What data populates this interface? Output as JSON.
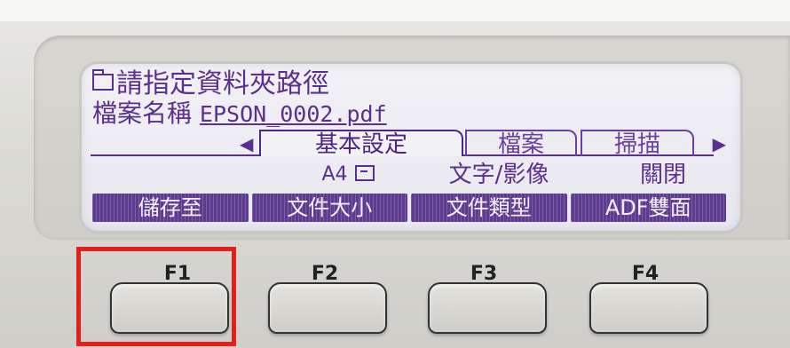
{
  "lcd": {
    "line1": "請指定資料夾路徑",
    "line2_label": "檔案名稱",
    "line2_filename": "EPSON_0002.pdf",
    "tabs": [
      "基本設定",
      "檔案",
      "掃描"
    ],
    "values": {
      "doc_size": "A4",
      "doc_type": "文字/影像",
      "adf_duplex": "關閉"
    },
    "function_labels": [
      "儲存至",
      "文件大小",
      "文件類型",
      "ADF雙面"
    ]
  },
  "buttons": [
    "F1",
    "F2",
    "F3",
    "F4"
  ],
  "colors": {
    "lcd_text": "#5b2f8e",
    "highlight": "#e0201b"
  }
}
